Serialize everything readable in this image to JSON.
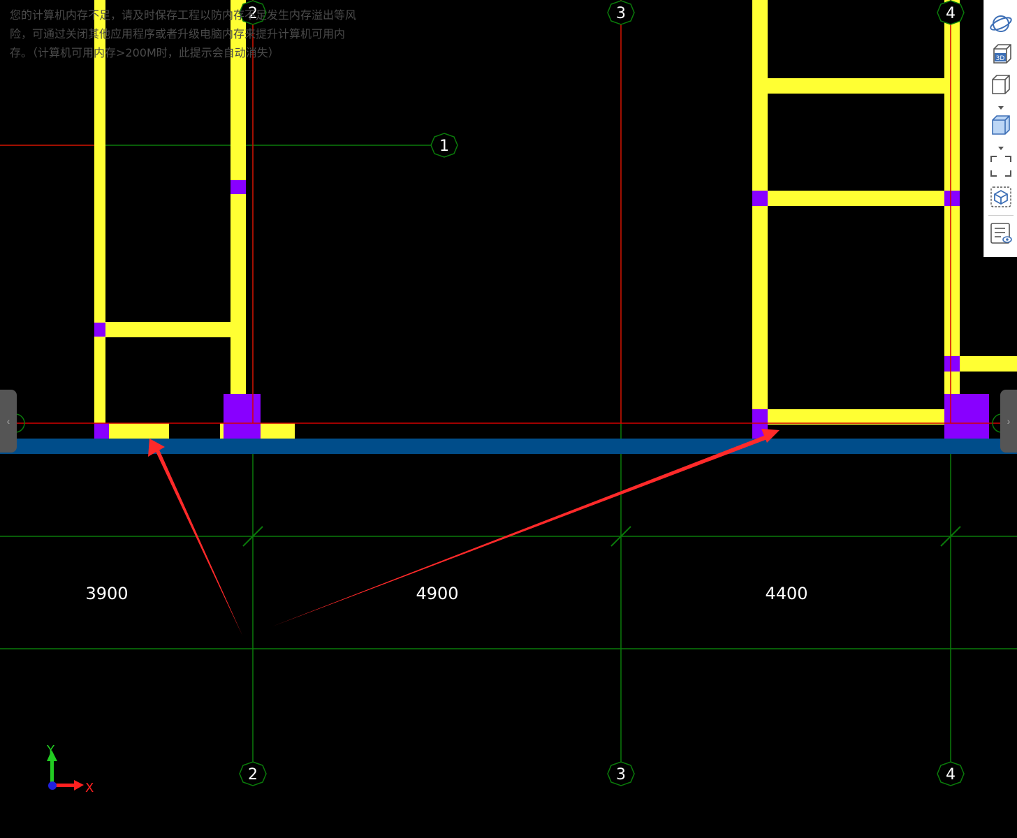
{
  "warning": {
    "line1": "您的计算机内存不足，请及时保存工程以防内存不足发生内存溢出等风",
    "line2": "险，可通过关闭其他应用程序或者升级电脑内存来提升计算机可用内",
    "line3": "存。（计算机可用内存>200M时，此提示会自动消失）"
  },
  "axes_top": [
    "2",
    "3",
    "4"
  ],
  "axes_bottom": [
    "2",
    "3",
    "4"
  ],
  "axis_row": "1",
  "dimensions": [
    "3900",
    "4900",
    "4400"
  ],
  "coord_axis": {
    "x_label": "X",
    "y_label": "Y"
  },
  "toolbar": {
    "items": [
      "orbit-icon",
      "3d-view-icon",
      "view-cube-icon",
      "shaded-cube-icon",
      "fit-extents-icon",
      "isolate-icon",
      "display-settings-icon"
    ]
  },
  "side_tabs": {
    "left_glyph": "‹",
    "right_glyph": "›"
  },
  "colors": {
    "background": "#000000",
    "beam": "#ffff33",
    "column": "#8800ff",
    "grid_line": "#0a7a0a",
    "axis_line_red": "#d40000",
    "slab_band": "#004d8a",
    "annotation_arrow": "#ff2a2a",
    "dimension_text": "#ffffff"
  }
}
